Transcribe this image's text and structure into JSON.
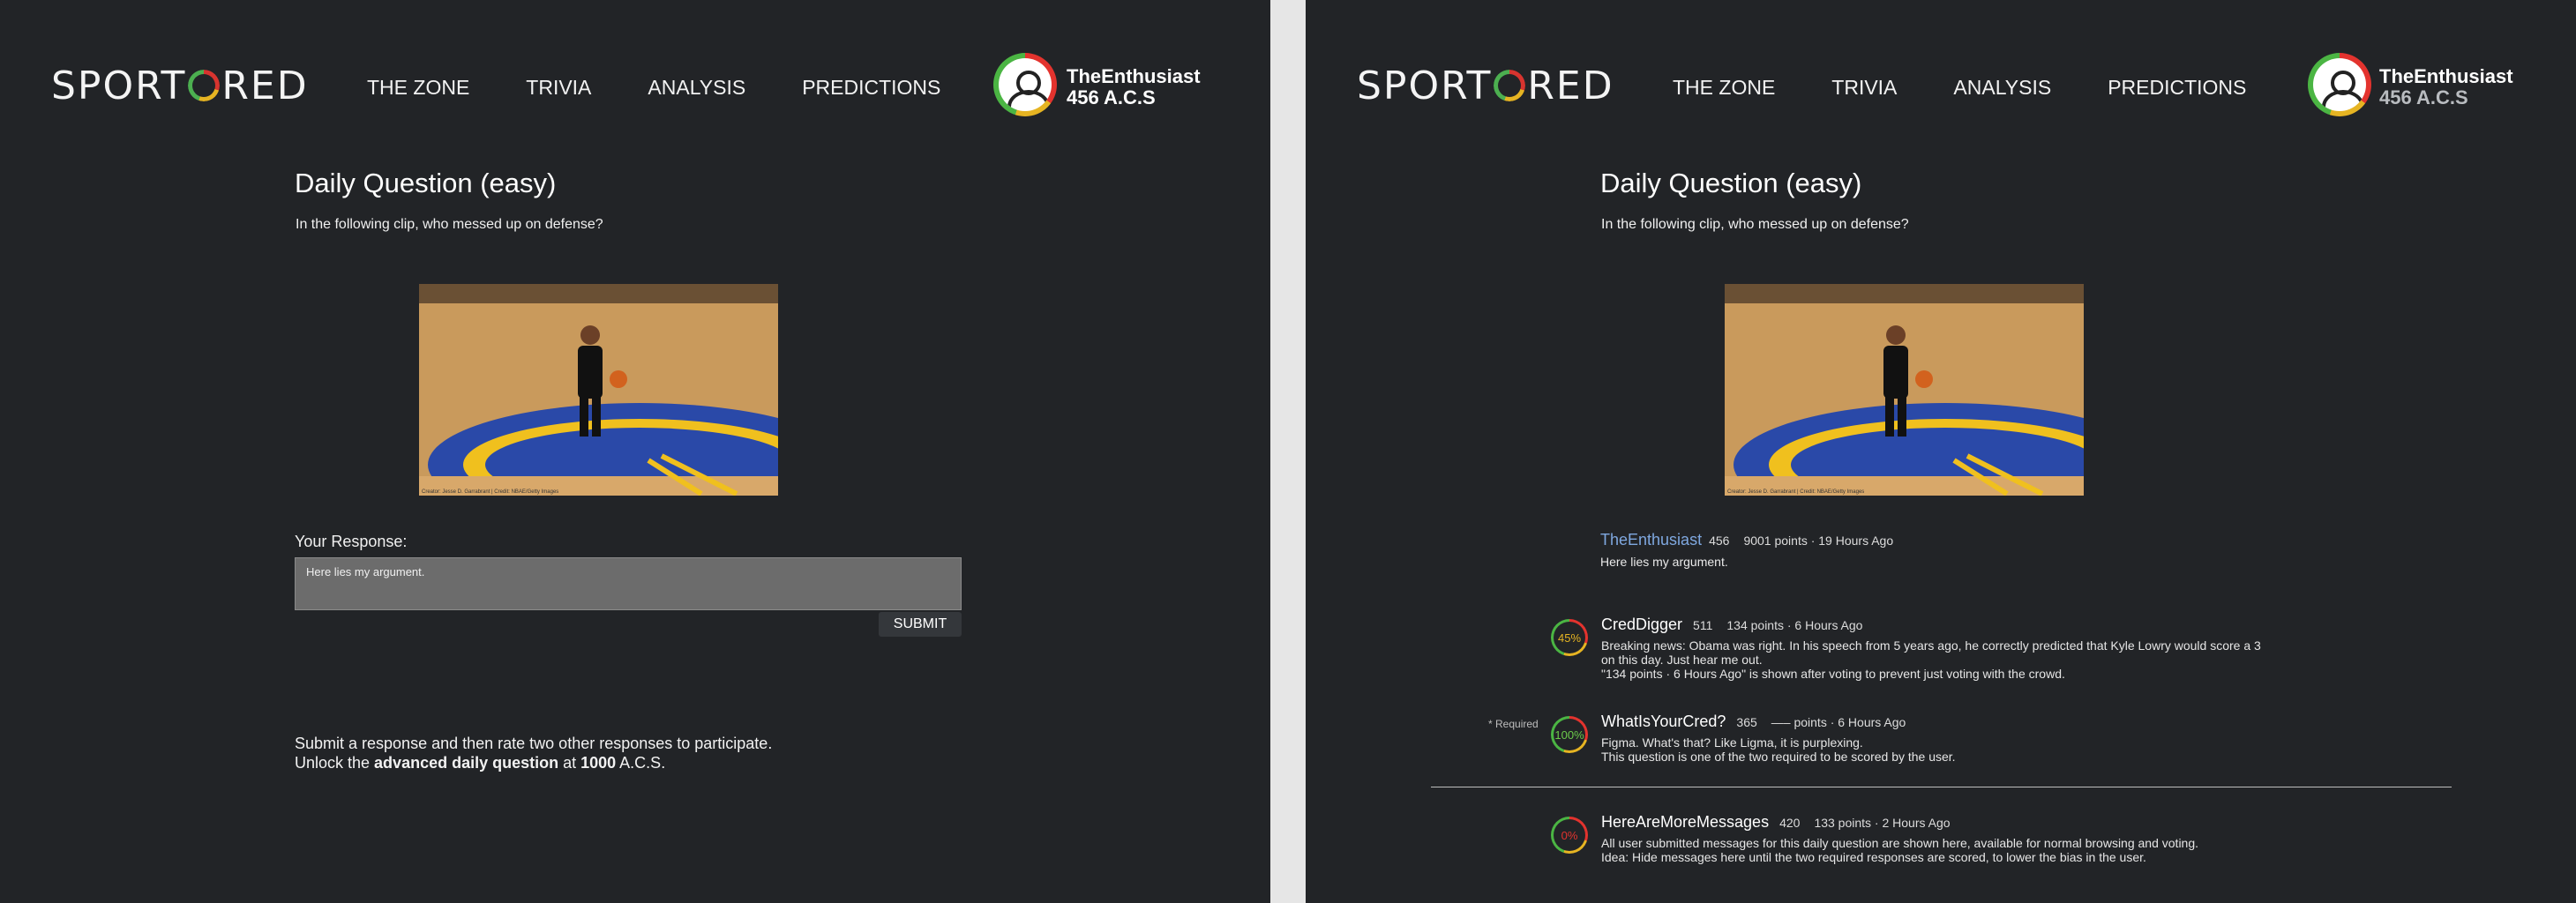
{
  "brand": {
    "logo_left": "SPORT",
    "logo_right": "RED"
  },
  "nav": [
    "THE ZONE",
    "TRIVIA",
    "ANALYSIS",
    "PREDICTIONS"
  ],
  "user": {
    "name": "TheEnthusiast",
    "acs": "456 A.C.S"
  },
  "question": {
    "title": "Daily Question (easy)",
    "prompt": "In the following clip, who messed up on defense?",
    "image_credit": "Creator: Jesse D. Garrabrant | Credit: NBAE/Getty Images"
  },
  "response": {
    "label": "Your Response:",
    "value": "Here lies my argument.",
    "submit": "SUBMIT"
  },
  "footer": {
    "line1": "Submit a response and then rate two other responses to participate.",
    "line2_a": "Unlock the ",
    "line2_b": "advanced daily question",
    "line2_c": " at ",
    "line2_d": "1000",
    "line2_e": " A.C.S."
  },
  "colors": {
    "acs_left": "#ffffff",
    "acs_right": "#b9bcc0",
    "op_name": "#7fa8e0"
  },
  "op_post": {
    "name": "TheEnthusiast",
    "cred": "456",
    "meta": "9001 points · 19 Hours Ago",
    "body": "Here lies my argument."
  },
  "required_note": "* Required",
  "comments": [
    {
      "badge": "45%",
      "badge_color": "#e6b422",
      "name": "CredDigger",
      "cred": "511",
      "meta": "134 points · 6 Hours Ago",
      "lines": [
        "Breaking news: Obama was right. In his speech from 5 years ago, he correctly predicted that Kyle Lowry would score a 3 on this day. Just hear me out.",
        "\"134 points · 6 Hours Ago\" is shown after voting to prevent just voting with the crowd."
      ]
    },
    {
      "badge": "100%",
      "badge_color": "#6ccb4b",
      "name": "WhatIsYourCred?",
      "cred": "365",
      "meta": "—– points · 6 Hours Ago",
      "lines": [
        "Figma. What's that? Like Ligma, it is purplexing.",
        "This question is one of the two required to be scored by the user."
      ]
    },
    {
      "badge": "0%",
      "badge_color": "#e3332e",
      "name": "HereAreMoreMessages",
      "cred": "420",
      "meta": "133 points · 2 Hours Ago",
      "lines": [
        "All user submitted messages for this daily question are shown here, available for normal browsing and voting.",
        "Idea: Hide messages here until the two required responses are scored, to lower the bias in the user."
      ]
    }
  ]
}
